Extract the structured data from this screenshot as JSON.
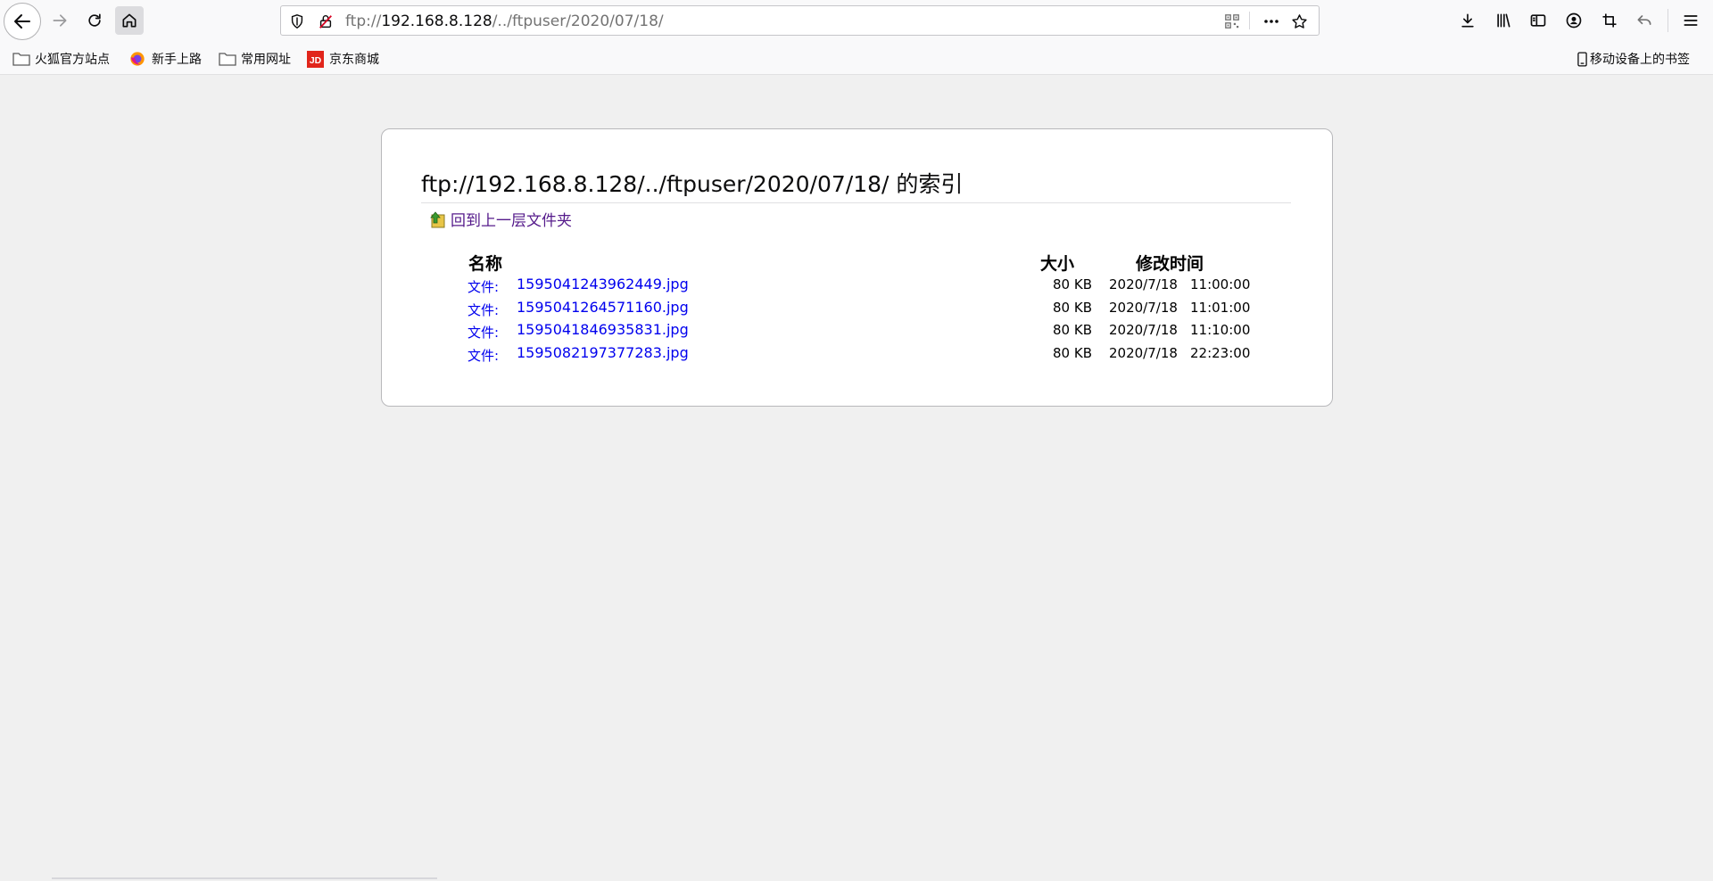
{
  "browser": {
    "url_prefix": "ftp://",
    "url_host": "192.168.8.128",
    "url_path": "/../ftpuser/2020/07/18/",
    "bookmarks": [
      {
        "label": "火狐官方站点",
        "icon": "folder-icon"
      },
      {
        "label": "新手上路",
        "icon": "firefox-icon"
      },
      {
        "label": "常用网址",
        "icon": "folder-icon"
      },
      {
        "label": "京东商城",
        "icon": "jd-icon"
      }
    ],
    "mobile_bookmarks": "移动设备上的书签"
  },
  "page": {
    "title": "ftp://192.168.8.128/../ftpuser/2020/07/18/ 的索引",
    "up_link": "回到上一层文件夹",
    "columns": {
      "name": "名称",
      "size": "大小",
      "modified": "修改时间"
    },
    "files": [
      {
        "type": "文件:",
        "name": "1595041243962449.jpg",
        "size": "80 KB",
        "date": "2020/7/18",
        "time": "11:00:00"
      },
      {
        "type": "文件:",
        "name": "1595041264571160.jpg",
        "size": "80 KB",
        "date": "2020/7/18",
        "time": "11:01:00"
      },
      {
        "type": "文件:",
        "name": "1595041846935831.jpg",
        "size": "80 KB",
        "date": "2020/7/18",
        "time": "11:10:00"
      },
      {
        "type": "文件:",
        "name": "1595082197377283.jpg",
        "size": "80 KB",
        "date": "2020/7/18",
        "time": "22:23:00"
      }
    ]
  }
}
